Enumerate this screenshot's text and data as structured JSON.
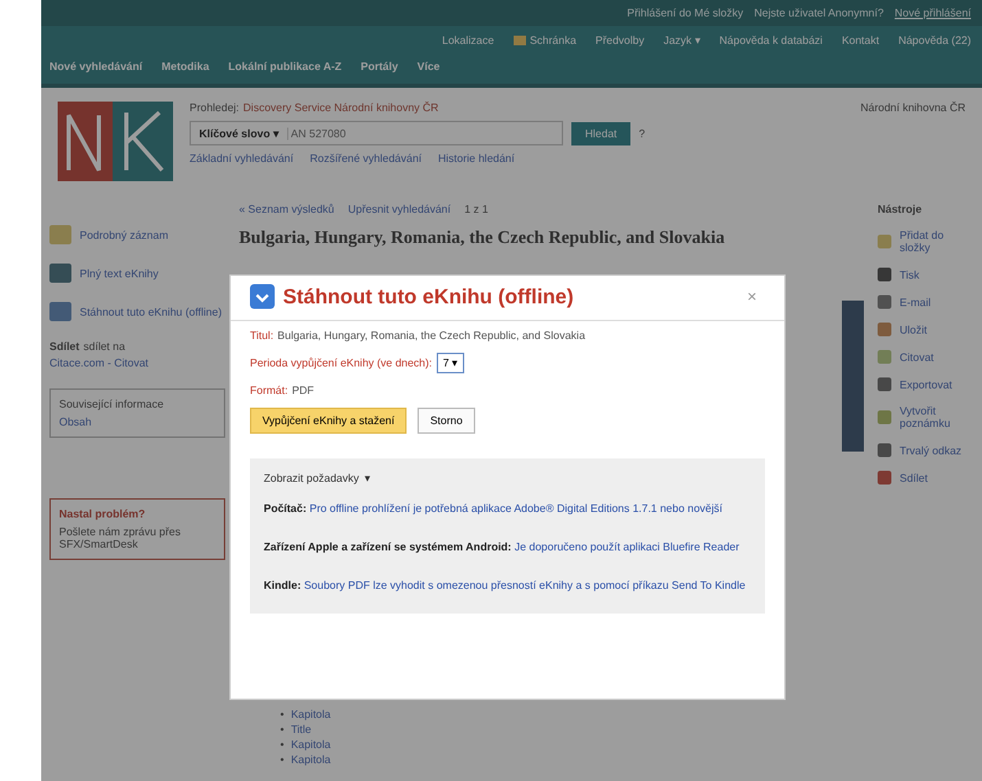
{
  "top_bar": {
    "links": [
      "Přihlášení do Mé složky",
      "Nejste uživatel Anonymní?",
      "Nové přihlášení"
    ]
  },
  "utility_nav": [
    {
      "label": "Lokalizace",
      "icon": false
    },
    {
      "label": "Schránka",
      "icon": true
    },
    {
      "label": "Předvolby",
      "icon": false
    },
    {
      "label": "Jazyk ▾",
      "icon": false
    },
    {
      "label": "Nápověda k databázi",
      "icon": false
    },
    {
      "label": "Kontakt",
      "icon": false
    },
    {
      "label": "Nápověda (22)",
      "icon": false
    }
  ],
  "main_nav": [
    "Nové vyhledávání",
    "Metodika",
    "Lokální publikace A-Z",
    "Portály",
    "Více"
  ],
  "header": {
    "search_label": "Prohledej:",
    "search_source": "Discovery Service Národní knihovny ČR",
    "field_select": "Klíčové slovo ▾",
    "query": "AN 527080",
    "search_button": "Hledat",
    "help": "?",
    "links": [
      "Základní vyhledávání",
      "Rozšířené vyhledávání",
      "Historie hledání"
    ],
    "institution": "Národní knihovna ČR"
  },
  "breadcrumb": {
    "back": "« Seznam výsledků",
    "refine": "Upřesnit vyhledávání",
    "position": "1 z 1"
  },
  "record_title": "Bulgaria, Hungary, Romania, the Czech Republic, and Slovakia",
  "left_menu": [
    "Podrobný záznam",
    "Plný text eKnihy",
    "Stáhnout tuto eKnihu (offline)"
  ],
  "share": {
    "label": "Sdílet",
    "rest": "sdílet na",
    "link": "Citace.com - Citovat"
  },
  "related": {
    "title": "Související informace",
    "item": "Obsah"
  },
  "problem": {
    "title": "Nastal problém?",
    "text": "Pošlete nám zprávu přes SFX/SmartDesk"
  },
  "tools": {
    "title": "Nástroje",
    "items": [
      "Přidat do složky",
      "Tisk",
      "E-mail",
      "Uložit",
      "Citovat",
      "Exportovat",
      "Vytvořit poznámku",
      "Trvalý odkaz",
      "Sdílet"
    ]
  },
  "contents_links": [
    {
      "marker": "•",
      "label": "Kapitola"
    },
    {
      "marker": "•",
      "label": "Title"
    },
    {
      "marker": "•",
      "label": "Kapitola"
    },
    {
      "marker": "•",
      "label": "Kapitola"
    }
  ],
  "dialog": {
    "title": "Stáhnout tuto eKnihu (offline)",
    "close": "×",
    "fields": [
      {
        "label": "Titul:",
        "value": "Bulgaria, Hungary, Romania, the Czech Republic, and Slovakia",
        "kind": "text"
      },
      {
        "label": "Perioda vypůjčení eKnihy (ve dnech):",
        "value": "7 ▾",
        "kind": "select"
      },
      {
        "label": "Formát:",
        "value": "PDF",
        "kind": "text"
      }
    ],
    "primary_button": "Vypůjčení eKnihy a stažení",
    "cancel_button": "Storno",
    "requirements": {
      "title": "Zobrazit požadavky",
      "toggle": "▾",
      "items": [
        {
          "label": "Počítač:",
          "text": "Pro offline prohlížení je potřebná aplikace Adobe® Digital Editions 1.7.1 nebo novější"
        },
        {
          "label": "Zařízení Apple a zařízení se systémem Android:",
          "text": "Je doporučeno použít aplikaci Bluefire Reader"
        },
        {
          "label": "Kindle:",
          "text": "Soubory PDF lze vyhodit s omezenou přesností eKnihy a s pomocí příkazu Send To Kindle"
        }
      ]
    }
  }
}
